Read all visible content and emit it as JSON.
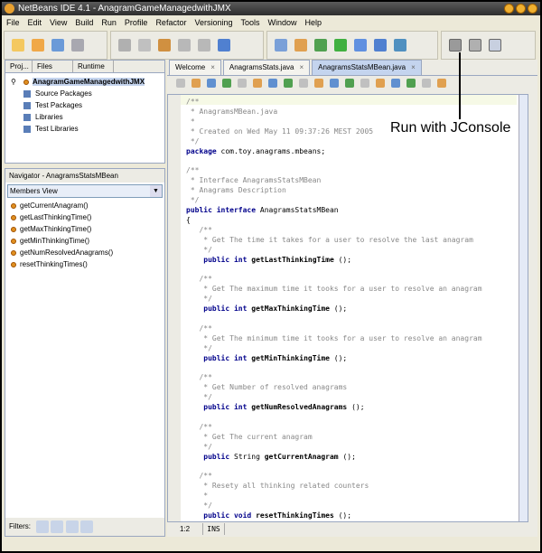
{
  "window": {
    "title": "NetBeans IDE 4.1 - AnagramGameManagedwithJMX"
  },
  "menu": [
    "File",
    "Edit",
    "View",
    "Build",
    "Run",
    "Profile",
    "Refactor",
    "Versioning",
    "Tools",
    "Window",
    "Help"
  ],
  "projects": {
    "tabs": [
      "Proj...",
      "Files",
      "Runtime"
    ],
    "root": "AnagramGameManagedwithJMX",
    "children": [
      "Source Packages",
      "Test Packages",
      "Libraries",
      "Test Libraries"
    ]
  },
  "navigator": {
    "title": "Navigator - AnagramsStatsMBean",
    "view": "Members View",
    "members": [
      "getCurrentAnagram()",
      "getLastThinkingTime()",
      "getMaxThinkingTime()",
      "getMinThinkingTime()",
      "getNumResolvedAnagrams()",
      "resetThinkingTimes()"
    ],
    "filters_label": "Filters:"
  },
  "editor": {
    "tabs": [
      "Welcome",
      "AnagramsStats.java",
      "AnagramsStatsMBean.java"
    ],
    "lines": [
      [
        [
          "c",
          "/**"
        ]
      ],
      [
        [
          "c",
          " * AnagramsMBean.java"
        ]
      ],
      [
        [
          "c",
          " *"
        ]
      ],
      [
        [
          "c",
          " * Created on Wed May 11 09:37:26 MEST 2005"
        ]
      ],
      [
        [
          "c",
          " */"
        ]
      ],
      [
        [
          "k",
          "package"
        ],
        [
          "",
          "com.toy.anagrams.mbeans;"
        ]
      ],
      [
        [
          "",
          ""
        ]
      ],
      [
        [
          "c",
          "/**"
        ]
      ],
      [
        [
          "c",
          " * Interface AnagramsStatsMBean"
        ]
      ],
      [
        [
          "c",
          " * Anagrams Description"
        ]
      ],
      [
        [
          "c",
          " */"
        ]
      ],
      [
        [
          "k",
          "public interface"
        ],
        [
          "",
          "AnagramsStatsMBean"
        ]
      ],
      [
        [
          "",
          "{"
        ]
      ],
      [
        [
          "c",
          "   /**"
        ]
      ],
      [
        [
          "c",
          "    * Get The time it takes for a user to resolve the last anagram"
        ]
      ],
      [
        [
          "c",
          "    */"
        ]
      ],
      [
        [
          "k",
          "    public int"
        ],
        [
          "m",
          "getLastThinkingTime"
        ],
        [
          "",
          "();"
        ]
      ],
      [
        [
          "",
          ""
        ]
      ],
      [
        [
          "c",
          "   /**"
        ]
      ],
      [
        [
          "c",
          "    * Get The maximum time it tooks for a user to resolve an anagram"
        ]
      ],
      [
        [
          "c",
          "    */"
        ]
      ],
      [
        [
          "k",
          "    public int"
        ],
        [
          "m",
          "getMaxThinkingTime"
        ],
        [
          "",
          "();"
        ]
      ],
      [
        [
          "",
          ""
        ]
      ],
      [
        [
          "c",
          "   /**"
        ]
      ],
      [
        [
          "c",
          "    * Get The minimum time it tooks for a user to resolve an anagram"
        ]
      ],
      [
        [
          "c",
          "    */"
        ]
      ],
      [
        [
          "k",
          "    public int"
        ],
        [
          "m",
          "getMinThinkingTime"
        ],
        [
          "",
          "();"
        ]
      ],
      [
        [
          "",
          ""
        ]
      ],
      [
        [
          "c",
          "   /**"
        ]
      ],
      [
        [
          "c",
          "    * Get Number of resolved anagrams"
        ]
      ],
      [
        [
          "c",
          "    */"
        ]
      ],
      [
        [
          "k",
          "    public int"
        ],
        [
          "m",
          "getNumResolvedAnagrams"
        ],
        [
          "",
          "();"
        ]
      ],
      [
        [
          "",
          ""
        ]
      ],
      [
        [
          "c",
          "   /**"
        ]
      ],
      [
        [
          "c",
          "    * Get The current anagram"
        ]
      ],
      [
        [
          "c",
          "    */"
        ]
      ],
      [
        [
          "k",
          "    public"
        ],
        [
          "",
          "String"
        ],
        [
          "m",
          "getCurrentAnagram"
        ],
        [
          "",
          "();"
        ]
      ],
      [
        [
          "",
          ""
        ]
      ],
      [
        [
          "c",
          "   /**"
        ]
      ],
      [
        [
          "c",
          "    * Resety all thinking related counters"
        ]
      ],
      [
        [
          "c",
          "    *"
        ]
      ],
      [
        [
          "c",
          "    */"
        ]
      ],
      [
        [
          "k",
          "    public void"
        ],
        [
          "m",
          "resetThinkingTimes"
        ],
        [
          "",
          "();"
        ]
      ]
    ],
    "status": {
      "position": "1:2",
      "mode": "INS"
    }
  },
  "annotation": "Run with JConsole",
  "colors": {
    "keyword": "#00008b",
    "comment": "#888888",
    "selection": "#c4d4ee",
    "current_line": "#f6f9e6"
  }
}
